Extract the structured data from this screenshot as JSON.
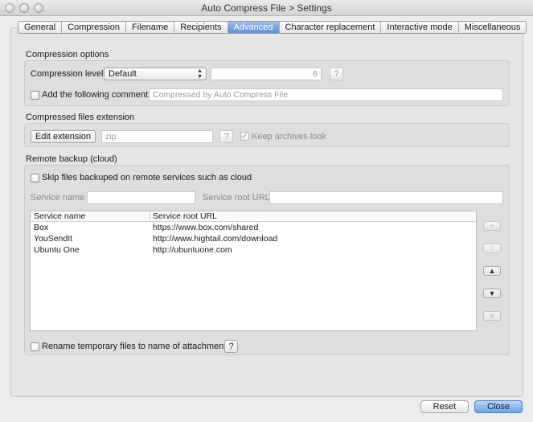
{
  "window": {
    "title": "Auto Compress File > Settings"
  },
  "tabs": [
    {
      "label": "General",
      "active": false
    },
    {
      "label": "Compression",
      "active": false
    },
    {
      "label": "Filename",
      "active": false
    },
    {
      "label": "Recipients",
      "active": false
    },
    {
      "label": "Advanced",
      "active": true
    },
    {
      "label": "Character replacement",
      "active": false
    },
    {
      "label": "Interactive mode",
      "active": false
    },
    {
      "label": "Miscellaneous",
      "active": false
    }
  ],
  "compression_options": {
    "section_title": "Compression options",
    "level_label": "Compression level",
    "level_value": "Default",
    "level_number": "6",
    "help_label": "?",
    "comment_checkbox_label": "Add the following comment",
    "comment_checked": false,
    "comment_placeholder": "Compressed by Auto Compress File"
  },
  "extension": {
    "section_title": "Compressed files extension",
    "edit_button": "Edit extension",
    "extension_value": "zip",
    "help_label": "?",
    "keep_look_label": "Keep archives look",
    "keep_look_checked": true
  },
  "remote_backup": {
    "section_title": "Remote backup (cloud)",
    "skip_label": "Skip files backuped on remote services such as cloud",
    "skip_checked": false,
    "service_name_label": "Service name",
    "service_root_label": "Service root URL",
    "table": {
      "headers": [
        "Service name",
        "Service root URL"
      ],
      "rows": [
        [
          "Box",
          "https://www.box.com/shared"
        ],
        [
          "YouSendIt",
          "http://www.hightail.com/download"
        ],
        [
          "Ubuntu One",
          "http://ubuntuone.com"
        ]
      ]
    },
    "side_buttons": [
      {
        "icon": "plus-icon",
        "glyph": "+",
        "enabled": false
      },
      {
        "icon": "pencil-icon",
        "glyph": "∕",
        "enabled": false
      },
      {
        "icon": "arrow-up-icon",
        "glyph": "▲",
        "enabled": true
      },
      {
        "icon": "arrow-down-icon",
        "glyph": "▼",
        "enabled": true
      },
      {
        "icon": "delete-icon",
        "glyph": "✕",
        "enabled": false
      }
    ],
    "rename_label": "Rename temporary files to name of attachment",
    "rename_checked": false,
    "help_label": "?"
  },
  "footer": {
    "reset_label": "Reset",
    "close_label": "Close"
  },
  "colors": {
    "accent": "#5d8fd7",
    "primary_button": "#6ea4e8"
  }
}
